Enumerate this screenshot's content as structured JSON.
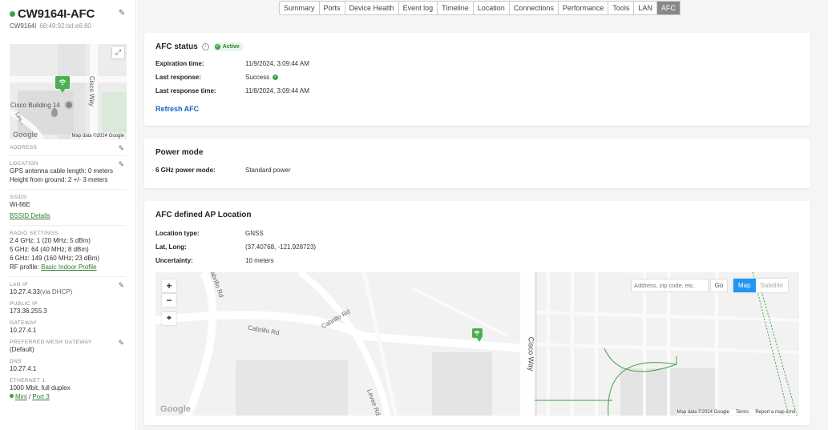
{
  "device": {
    "name": "CW9164I-AFC",
    "model": "CW9164I",
    "mac": "68:49:92:bd:e6:80"
  },
  "side_map": {
    "credit": "Map data ©2024 Google",
    "google": "Google",
    "building_label": "Cisco Building 14",
    "road_label": "Cisco Way",
    "road_label2": "Lev..."
  },
  "sidebar": {
    "address_label": "ADDRESS",
    "location_label": "LOCATION",
    "location_line1": "GPS antenna cable length: 0 meters",
    "location_line2": "Height from ground: 2 +/- 3 meters",
    "ssids_label": "SSIDS",
    "ssids_value": "Wi-fi6E",
    "bssid_link": "BSSID Details",
    "radio_label": "RADIO SETTINGS",
    "radio_24": "2.4 GHz: 1 (20 MHz; 5 dBm)",
    "radio_5": "5 GHz: 64 (40 MHz; 8 dBm)",
    "radio_6": "6 GHz: 149 (160 MHz; 23 dBm)",
    "rf_profile_prefix": "RF profile: ",
    "rf_profile_link": "Basic Indoor Profile",
    "lan_ip_label": "LAN IP",
    "lan_ip_value": "10.27.4.33",
    "lan_ip_suffix": "(via DHCP)",
    "public_ip_label": "PUBLIC IP",
    "public_ip_value": "173.36.255.3",
    "gateway_label": "GATEWAY",
    "gateway_value": "10.27.4.1",
    "mesh_label": "PREFERRED MESH GATEWAY",
    "mesh_value": "(Default)",
    "dns_label": "DNS",
    "dns_value": "10.27.4.1",
    "eth_label": "ETHERNET 1",
    "eth_value": "1000 Mbit, full duplex",
    "eth_link1": "Mini",
    "eth_sep": " / ",
    "eth_link2": "Port 3"
  },
  "tabs": [
    "Summary",
    "Ports",
    "Device Health",
    "Event log",
    "Timeline",
    "Location",
    "Connections",
    "Performance",
    "Tools",
    "LAN",
    "AFC"
  ],
  "active_tab": "AFC",
  "afc_status": {
    "title": "AFC status",
    "badge": "Active",
    "rows": [
      {
        "k": "Expiration time:",
        "v": "11/9/2024, 3:09:44 AM"
      },
      {
        "k": "Last response:",
        "v": "Success"
      },
      {
        "k": "Last response time:",
        "v": "11/8/2024, 3:09:44 AM"
      }
    ],
    "refresh": "Refresh AFC"
  },
  "power_mode": {
    "title": "Power mode",
    "k": "6 GHz power mode:",
    "v": "Standard power"
  },
  "afc_location": {
    "title": "AFC defined AP Location",
    "rows": [
      {
        "k": "Location type:",
        "v": "GNSS"
      },
      {
        "k": "Lat, Long:",
        "v": "(37.40768, -121.928723)"
      },
      {
        "k": "Uncertainty:",
        "v": "10 meters"
      }
    ]
  },
  "big_map": {
    "search_placeholder": "Address, zip code, etc.",
    "go": "Go",
    "map": "Map",
    "satellite": "Satellite",
    "zoom_in": "+",
    "zoom_out": "−",
    "credit": "Map data ©2024 Google",
    "terms": "Terms",
    "report": "Report a map error",
    "google": "Google",
    "road1": "Cabrillo Rd",
    "road2": "Cabrillo Rd",
    "road3": "Cabrillo Rd",
    "road4": "Cisco Way",
    "road5": "Levee Rd"
  },
  "colors": {
    "accent_green": "#43a047",
    "link_blue": "#1565c0",
    "map_button_blue": "#2196f3"
  }
}
